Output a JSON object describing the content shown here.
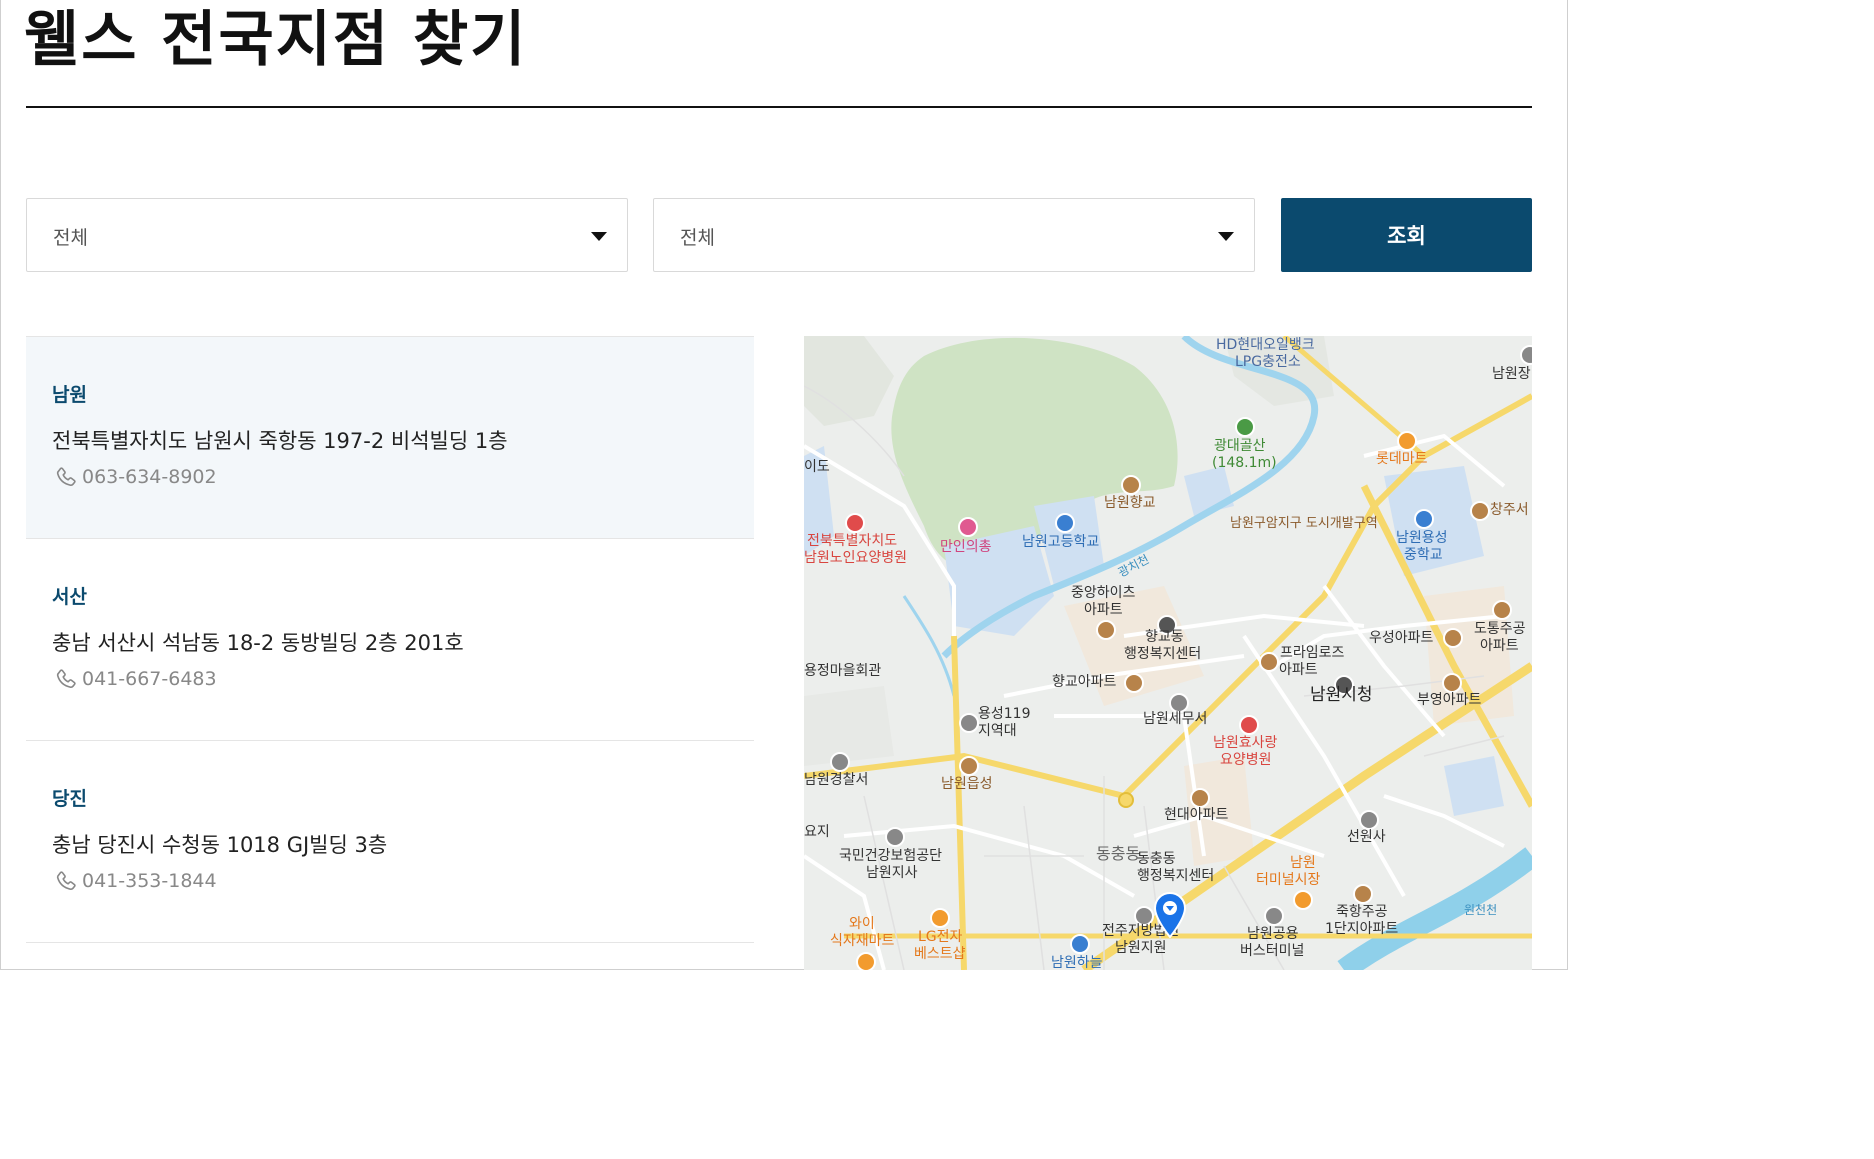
{
  "page": {
    "title": "웰스 전국지점 찾기"
  },
  "filters": {
    "region_selected": "전체",
    "city_selected": "전체",
    "search_label": "조회"
  },
  "branches": [
    {
      "name": "남원",
      "address": "전북특별자치도 남원시 죽항동 197-2 비석빌딩 1층",
      "phone": "063-634-8902",
      "active": true
    },
    {
      "name": "서산",
      "address": "충남 서산시 석남동 18-2 동방빌딩 2층 201호",
      "phone": "041-667-6483",
      "active": false
    },
    {
      "name": "당진",
      "address": "충남 당진시 수청동 1018 GJ빌딩 3층",
      "phone": "041-353-1844",
      "active": false
    }
  ],
  "map": {
    "labels": {
      "hd_oilbank": "HD현대오일뱅크",
      "lpg": "LPG충전소",
      "namwonjang": "남원장",
      "gwangdaegol": "광대골산",
      "gwangdaegol_height": "(148.1m)",
      "lotte_mart": "롯데마트",
      "namwon_hyanggyo": "남원향교",
      "changju": "창주서",
      "jeonbuk_1": "전북특별자치도",
      "jeonbuk_2": "남원노인요양병원",
      "maninuichong": "만인의총",
      "namwon_highschool": "남원고등학교",
      "gucamji": "남원구암지구 도시개발구역",
      "namwon_yongseong_1": "남원용성",
      "namwon_yongseong_2": "중학교",
      "ido": "이도",
      "gwangchi_stream": "광치천",
      "jungang_heights_1": "중앙하이츠",
      "jungang_heights_2": "아파트",
      "hyanggyodong_1": "향교동",
      "hyanggyodong_2": "행정복지센터",
      "primrose_1": "프라임로즈",
      "primrose_2": "아파트",
      "useong_apt": "우성아파트",
      "dotong_1": "도통주공",
      "dotong_2": "아파트",
      "jeongmaeul": "용정마을회관",
      "hyanggyo_apt": "향교아파트",
      "namwon_cityhall": "남원시청",
      "buyeong_apt": "부영아파트",
      "yongseong119_1": "용성119",
      "yongseong119_2": "지역대",
      "namwon_tax": "남원세무서",
      "hyosarang_1": "남원효사랑",
      "hyosarang_2": "요양병원",
      "police": "남원경찰서",
      "namwoneup": "남원읍성",
      "hyundai_apt": "현대아파트",
      "seonwonsa": "선원사",
      "nhis_1": "국민건강보험공단",
      "nhis_2": "남원지사",
      "dongchungdong": "동충동",
      "dongchung_office_1": "동충동",
      "dongchung_office_2": "행정복지센터",
      "terminal_1": "남원",
      "terminal_2": "터미널시장",
      "jukhang_1": "죽항주공",
      "jukhang_2": "1단지아파트",
      "woncheon": "원천천",
      "wai_1": "와이",
      "wai_2": "식자재마트",
      "lg_1": "LG전자",
      "lg_2": "베스트샵",
      "court_1": "전주지방법원",
      "court_2": "남원지원",
      "bus_1": "남원공용",
      "bus_2": "버스터미널",
      "haneul": "남원하늘",
      "yongji": "요지",
      "dongchung_label": "동충동"
    }
  }
}
